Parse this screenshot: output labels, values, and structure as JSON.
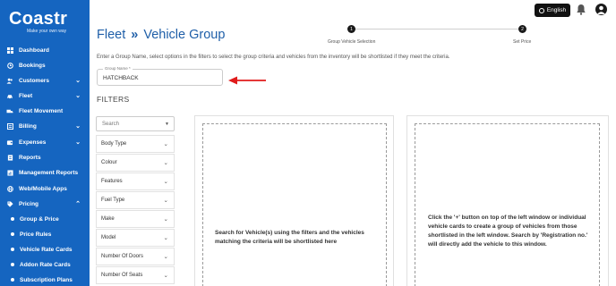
{
  "brand": {
    "name": "Coastr",
    "tagline": "Make your own way"
  },
  "sidebar": {
    "items": [
      {
        "label": "Dashboard",
        "icon": "grid-icon",
        "has_chevron": false
      },
      {
        "label": "Bookings",
        "icon": "calendar-icon",
        "has_chevron": false
      },
      {
        "label": "Customers",
        "icon": "users-icon",
        "has_chevron": true
      },
      {
        "label": "Fleet",
        "icon": "car-icon",
        "has_chevron": true
      },
      {
        "label": "Fleet Movement",
        "icon": "truck-icon",
        "has_chevron": false
      },
      {
        "label": "Billing",
        "icon": "billing-icon",
        "has_chevron": true
      },
      {
        "label": "Expenses",
        "icon": "wallet-icon",
        "has_chevron": true
      },
      {
        "label": "Reports",
        "icon": "report-icon",
        "has_chevron": false
      },
      {
        "label": "Management Reports",
        "icon": "chart-icon",
        "has_chevron": false
      },
      {
        "label": "Web/Mobile Apps",
        "icon": "globe-icon",
        "has_chevron": false
      },
      {
        "label": "Pricing",
        "icon": "tag-icon",
        "has_chevron": true
      }
    ],
    "pricing_subitems": [
      {
        "label": "Group & Price"
      },
      {
        "label": "Price Rules"
      },
      {
        "label": "Vehicle Rate Cards"
      },
      {
        "label": "Addon Rate Cards"
      },
      {
        "label": "Subscription Plans"
      }
    ]
  },
  "topbar": {
    "language_label": "English"
  },
  "header": {
    "breadcrumb_parent": "Fleet",
    "breadcrumb_separator": "»",
    "breadcrumb_current": "Vehicle Group"
  },
  "stepper": {
    "steps": [
      {
        "number": "1",
        "label": "Group Vehicle Selection"
      },
      {
        "number": "2",
        "label": "Set Price"
      }
    ]
  },
  "instruction": "Enter a Group Name, select options in the filters to select the group criteria and vehicles from the inventory will be shortlisted if they meet the criteria.",
  "group_name": {
    "label": "Group Name *",
    "value": "HATCHBACK"
  },
  "filters": {
    "title": "FILTERS",
    "search_placeholder": "Search",
    "rows": [
      {
        "label": "Body Type"
      },
      {
        "label": "Colour"
      },
      {
        "label": "Features"
      },
      {
        "label": "Fuel Type"
      },
      {
        "label": "Make"
      },
      {
        "label": "Model"
      },
      {
        "label": "Number Of Doors"
      },
      {
        "label": "Number Of Seats"
      }
    ]
  },
  "panels": {
    "left_text": "Search for Vehicle(s) using the filters and the vehicles matching the criteria will be shortlisted here",
    "right_text": "Click the '+' button on top of the left window or individual vehicle cards to create a group of vehicles from those shortlisted in the left window. Search by 'Registration no.' will directly add the vehicle to this window."
  },
  "colors": {
    "sidebar_bg": "#1565c0",
    "accent_blue": "#1f5fa8",
    "annotation_arrow": "#e01b1b"
  }
}
